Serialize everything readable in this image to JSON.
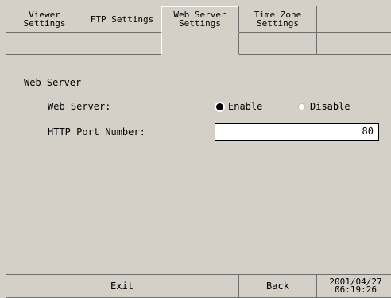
{
  "tabs_top": [
    {
      "label": "Viewer\nSettings",
      "active": false
    },
    {
      "label": "FTP Settings",
      "active": false
    },
    {
      "label": "Web Server\nSettings",
      "active": true
    },
    {
      "label": "Time Zone\nSettings",
      "active": false
    },
    {
      "label": "",
      "active": false
    }
  ],
  "panel": {
    "section_title": "Web Server",
    "web_server_label": "Web Server:",
    "enable_label": "Enable",
    "disable_label": "Disable",
    "selected": "Enable",
    "http_port_label": "HTTP Port Number:",
    "http_port_value": "80"
  },
  "bottom": {
    "exit_label": "Exit",
    "back_label": "Back",
    "datetime": "2001/04/27\n06:19:26"
  },
  "colors": {
    "background": "#d4d0c8",
    "border": "#6e6e6e",
    "input_bg": "#ffffff"
  }
}
